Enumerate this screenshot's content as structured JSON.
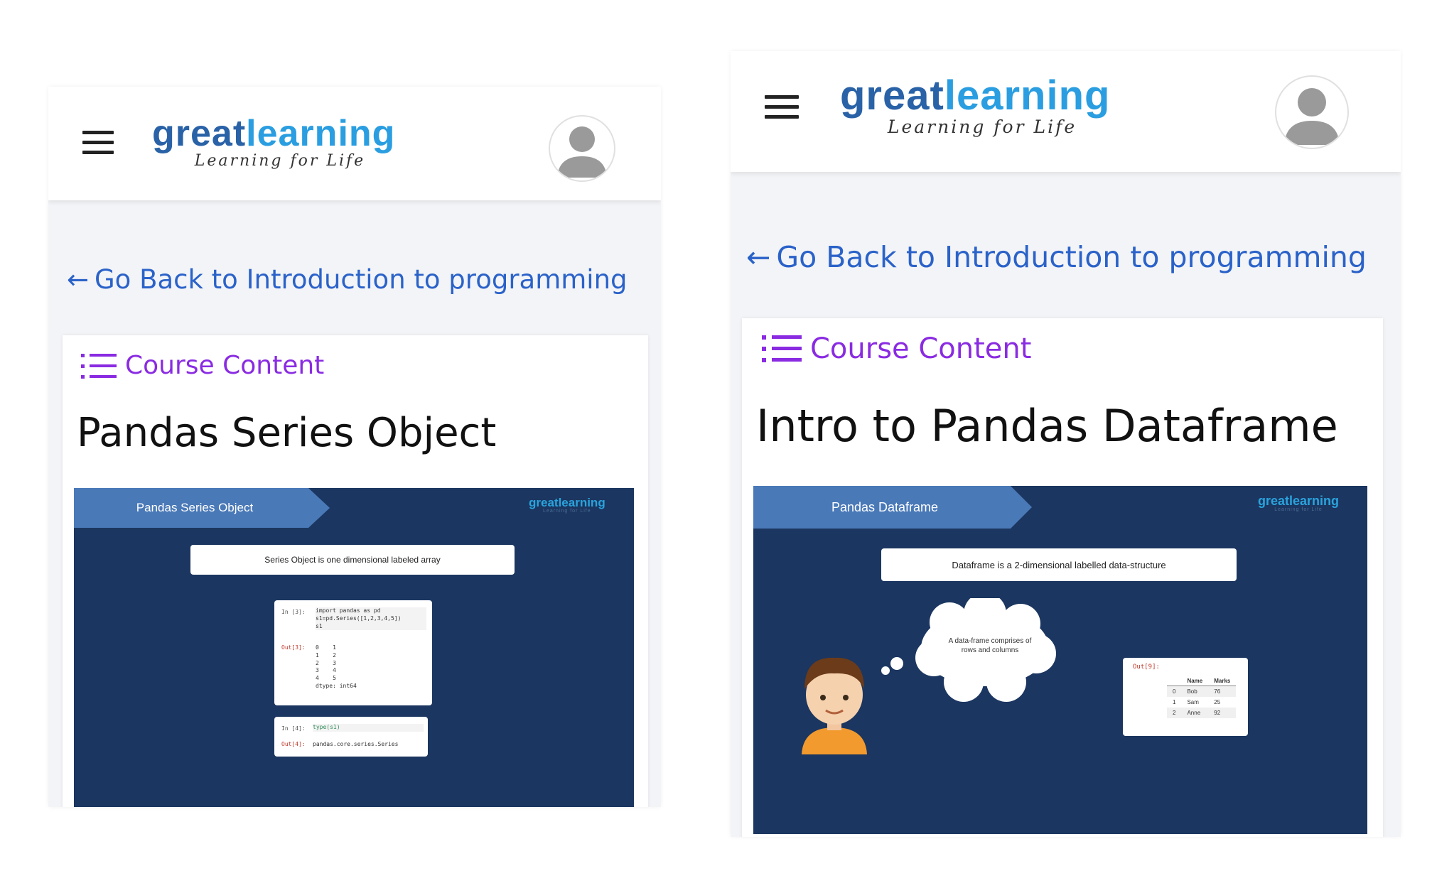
{
  "left": {
    "logo": {
      "part_a": "great",
      "part_b": "learning",
      "tagline": "Learning for Life"
    },
    "back_link": {
      "arrow": "←",
      "label": "Go Back to Introduction to programming"
    },
    "course_content": "Course Content",
    "title": "Pandas Series Object",
    "slide": {
      "banner": "Pandas Series Object",
      "logo_a": "great",
      "logo_b": "learning",
      "logo_tag": "Learning for Life",
      "definition": "Series Object is one dimensional labeled array",
      "code1_in_prompt": "In [3]:",
      "code1_in": "import pandas as pd\ns1=pd.Series([1,2,3,4,5])\ns1",
      "code1_out_prompt": "Out[3]:",
      "code1_out": "0    1\n1    2\n2    3\n3    4\n4    5\ndtype: int64",
      "code2_in_prompt": "In [4]:",
      "code2_in": "type(s1)",
      "code2_out_prompt": "Out[4]:",
      "code2_out": "pandas.core.series.Series"
    }
  },
  "right": {
    "logo": {
      "part_a": "great",
      "part_b": "learning",
      "tagline": "Learning for Life"
    },
    "back_link": {
      "arrow": "←",
      "label": "Go Back to Introduction to programming"
    },
    "course_content": "Course Content",
    "title": "Intro to Pandas Dataframe",
    "slide": {
      "banner": "Pandas Dataframe",
      "logo_a": "great",
      "logo_b": "learning",
      "logo_tag": "Learning for Life",
      "definition": "Dataframe is a 2-dimensional labelled data-structure",
      "thought": "A data-frame comprises of rows and columns",
      "out_prompt": "Out[9]:",
      "table": {
        "columns": [
          "",
          "Name",
          "Marks"
        ],
        "rows": [
          [
            "0",
            "Bob",
            "76"
          ],
          [
            "1",
            "Sam",
            "25"
          ],
          [
            "2",
            "Anne",
            "92"
          ]
        ]
      }
    }
  },
  "colors": {
    "link_blue": "#2a62c9",
    "course_purple": "#8a2be2",
    "slide_navy": "#1b3660",
    "banner_blue": "#4a79b8",
    "logo_dark": "#2a62a7",
    "logo_light": "#2a9ee0"
  }
}
